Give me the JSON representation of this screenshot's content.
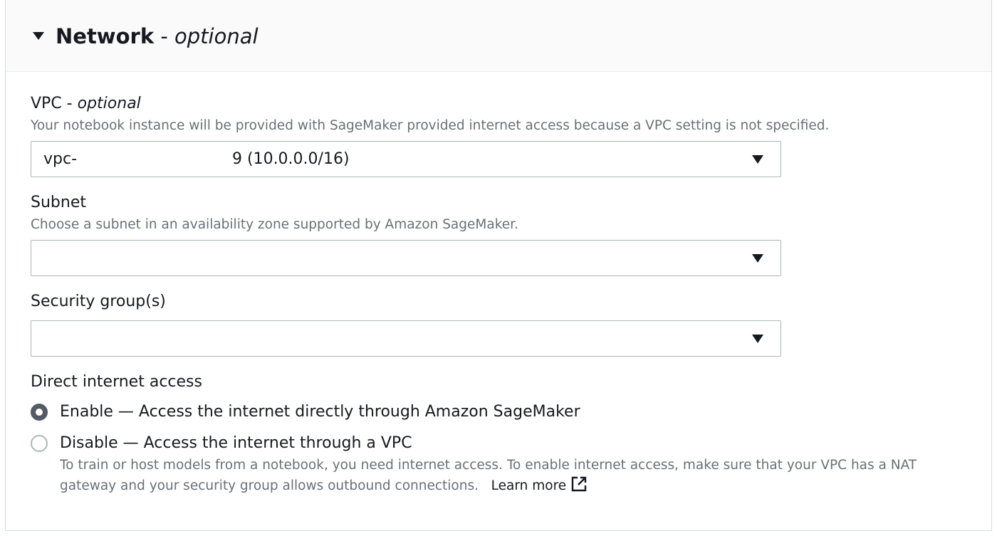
{
  "section": {
    "title": "Network",
    "separator": " - ",
    "title_suffix": "optional"
  },
  "vpc": {
    "label": "VPC",
    "separator": " - ",
    "label_suffix": "optional",
    "description": "Your notebook instance will be provided with SageMaker provided internet access because a VPC setting is not specified.",
    "value_prefix": "vpc-",
    "value_suffix": "9 (10.0.0.0/16)"
  },
  "subnet": {
    "label": "Subnet",
    "description": "Choose a subnet in an availability zone supported by Amazon SageMaker.",
    "value": ""
  },
  "security_groups": {
    "label": "Security group(s)",
    "value": ""
  },
  "internet_access": {
    "label": "Direct internet access",
    "options": [
      {
        "label": "Enable — Access the internet directly through Amazon SageMaker",
        "selected": true
      },
      {
        "label": "Disable — Access the internet through a VPC",
        "selected": false
      }
    ],
    "note_line1": "To train or host models from a notebook, you need internet access. To enable internet access, make sure that your VPC has a NAT",
    "note_line2": "gateway and your security group allows outbound connections.",
    "learn_more": "Learn more"
  },
  "icons": {
    "expand": "caret-down-icon",
    "dropdown": "caret-down-icon",
    "external_link": "external-link-icon"
  }
}
